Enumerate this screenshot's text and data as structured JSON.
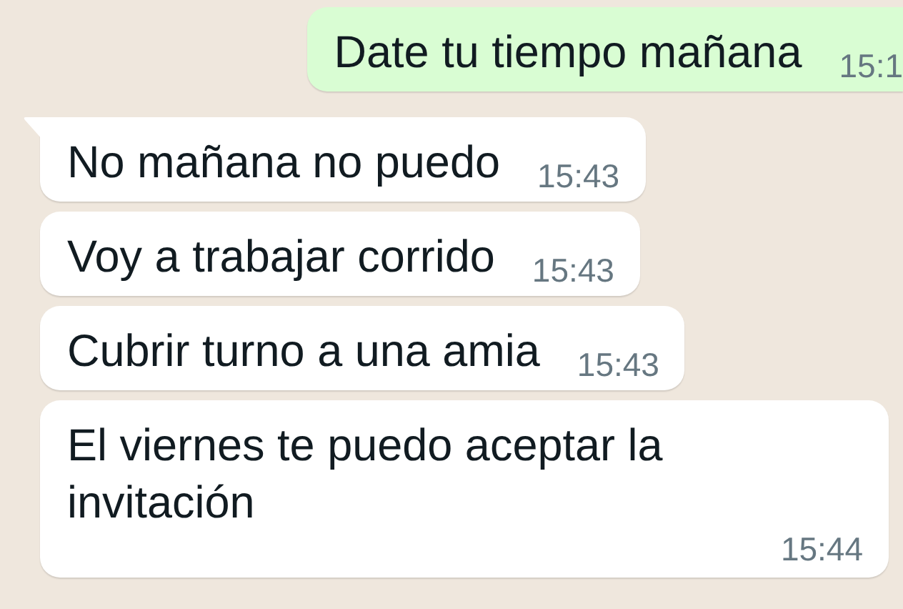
{
  "messages": [
    {
      "kind": "outgoing",
      "text": "Date tu tiempo mañana",
      "time": "15:1"
    },
    {
      "kind": "incoming",
      "text": "No mañana no puedo",
      "time": "15:43",
      "tail": true
    },
    {
      "kind": "incoming",
      "text": "Voy a trabajar corrido",
      "time": "15:43",
      "tail": false
    },
    {
      "kind": "incoming",
      "text": "Cubrir turno a una amia",
      "time": "15:43",
      "tail": false
    },
    {
      "kind": "incoming",
      "text": "El viernes te puedo aceptar la invitación",
      "time": "15:44",
      "tail": false
    }
  ]
}
